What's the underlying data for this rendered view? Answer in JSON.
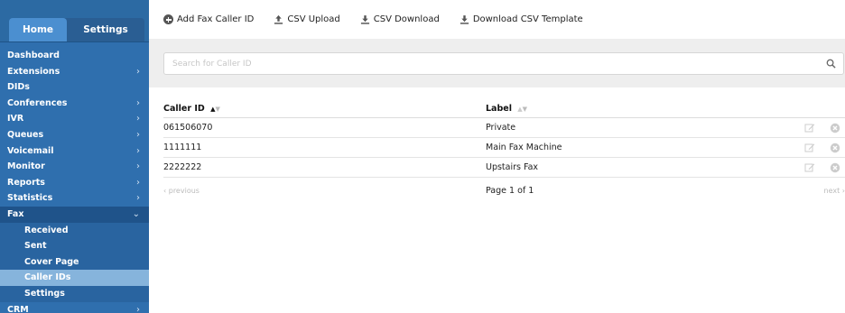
{
  "sidebar": {
    "tabs": [
      {
        "label": "Home",
        "active": true
      },
      {
        "label": "Settings",
        "active": false
      }
    ],
    "menu": [
      {
        "label": "Dashboard",
        "chevron": ""
      },
      {
        "label": "Extensions",
        "chevron": "›"
      },
      {
        "label": "DIDs",
        "chevron": ""
      },
      {
        "label": "Conferences",
        "chevron": "›"
      },
      {
        "label": "IVR",
        "chevron": "›"
      },
      {
        "label": "Queues",
        "chevron": "›"
      },
      {
        "label": "Voicemail",
        "chevron": "›"
      },
      {
        "label": "Monitor",
        "chevron": "›"
      },
      {
        "label": "Reports",
        "chevron": "›"
      },
      {
        "label": "Statistics",
        "chevron": "›"
      }
    ],
    "fax": {
      "label": "Fax",
      "chevron": "⌄",
      "subitems": [
        {
          "label": "Received"
        },
        {
          "label": "Sent"
        },
        {
          "label": "Cover Page"
        },
        {
          "label": "Caller IDs"
        },
        {
          "label": "Settings"
        }
      ]
    },
    "crm": {
      "label": "CRM",
      "chevron": "›"
    }
  },
  "toolbar": {
    "add_label": "Add Fax Caller ID",
    "upload_label": "CSV Upload",
    "download_label": "CSV Download",
    "template_label": "Download CSV Template"
  },
  "search": {
    "placeholder": "Search for Caller ID",
    "value": ""
  },
  "table": {
    "columns": [
      "Caller ID",
      "Label"
    ],
    "rows": [
      {
        "caller_id": "061506070",
        "label": "Private"
      },
      {
        "caller_id": "1111111",
        "label": "Main Fax Machine"
      },
      {
        "caller_id": "2222222",
        "label": "Upstairs Fax"
      }
    ],
    "sort_up": "▲",
    "sort_down": "▼"
  },
  "pager": {
    "previous": "‹ previous",
    "page_label": "Page 1 of 1",
    "next": "next ›"
  },
  "colors": {
    "sidebar_bg": "#2f6fae",
    "active_tab": "#4b8fd0",
    "active_subitem": "#86b4dc"
  }
}
